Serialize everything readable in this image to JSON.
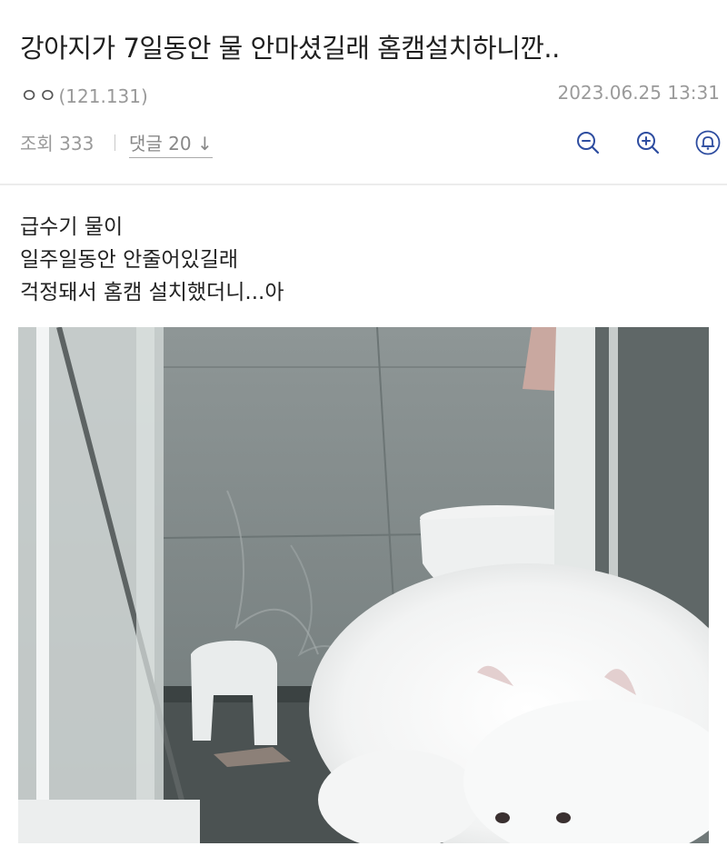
{
  "post": {
    "title": "강아지가 7일동안 물 안마셨길래 홈캠설치하니깐..",
    "author": "ㅇㅇ",
    "author_ip": "(121.131)",
    "date": "2023.06.25 13:31",
    "views": "조회 333",
    "comments": "댓글 20",
    "comments_arrow": "↓",
    "body_lines": [
      "급수기 물이",
      "일주일동안 안줄어있길래",
      "걱정돼서 홈캠 설치했더니...아"
    ]
  },
  "toolbar": {
    "zoom_out_icon": "zoom-out-icon",
    "zoom_in_icon": "zoom-in-icon",
    "bell_icon": "bell-icon",
    "icon_color": "#2e4da0"
  },
  "image": {
    "subject": "photo"
  }
}
